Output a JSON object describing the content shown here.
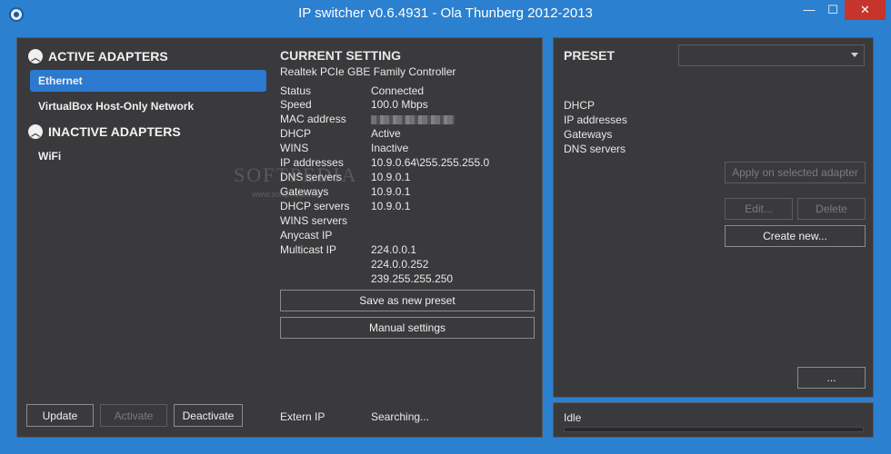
{
  "window": {
    "title": "IP switcher v0.6.4931 - Ola Thunberg 2012-2013",
    "minimize_glyph": "—",
    "maximize_glyph": "☐",
    "close_glyph": "✕"
  },
  "adapters": {
    "active_header": "ACTIVE ADAPTERS",
    "active": [
      "Ethernet",
      "VirtualBox Host-Only Network"
    ],
    "inactive_header": "INACTIVE ADAPTERS",
    "inactive": [
      "WiFi"
    ],
    "selected": "Ethernet"
  },
  "current": {
    "title": "CURRENT SETTING",
    "adapter_name": "Realtek PCIe GBE Family Controller",
    "fields": [
      {
        "key": "Status",
        "value": "Connected"
      },
      {
        "key": "Speed",
        "value": "100.0 Mbps"
      },
      {
        "key": "MAC address",
        "value": ""
      },
      {
        "key": "DHCP",
        "value": "Active"
      },
      {
        "key": "WINS",
        "value": "Inactive"
      },
      {
        "key": "IP addresses",
        "value": "10.9.0.64\\255.255.255.0"
      },
      {
        "key": "DNS servers",
        "value": "10.9.0.1"
      },
      {
        "key": "Gateways",
        "value": "10.9.0.1"
      },
      {
        "key": "DHCP servers",
        "value": "10.9.0.1"
      },
      {
        "key": "WINS servers",
        "value": ""
      },
      {
        "key": "Anycast IP",
        "value": ""
      },
      {
        "key": "Multicast IP",
        "value": "224.0.0.1"
      }
    ],
    "multicast_extra": [
      "224.0.0.252",
      "239.255.255.250"
    ],
    "save_preset": "Save as new preset",
    "manual_settings": "Manual settings",
    "extern_ip_label": "Extern IP",
    "extern_ip_value": "Searching..."
  },
  "buttons": {
    "update": "Update",
    "activate": "Activate",
    "deactivate": "Deactivate"
  },
  "preset": {
    "title": "PRESET",
    "selected": "",
    "labels": [
      "DHCP",
      "IP addresses",
      "Gateways",
      "DNS servers"
    ],
    "apply": "Apply on selected adapter",
    "edit": "Edit...",
    "delete": "Delete",
    "create": "Create new...",
    "more": "..."
  },
  "status": {
    "text": "Idle",
    "progress": 0
  },
  "watermark": {
    "main": "SOFTPEDIA",
    "sub": "www.softpedia.com"
  }
}
